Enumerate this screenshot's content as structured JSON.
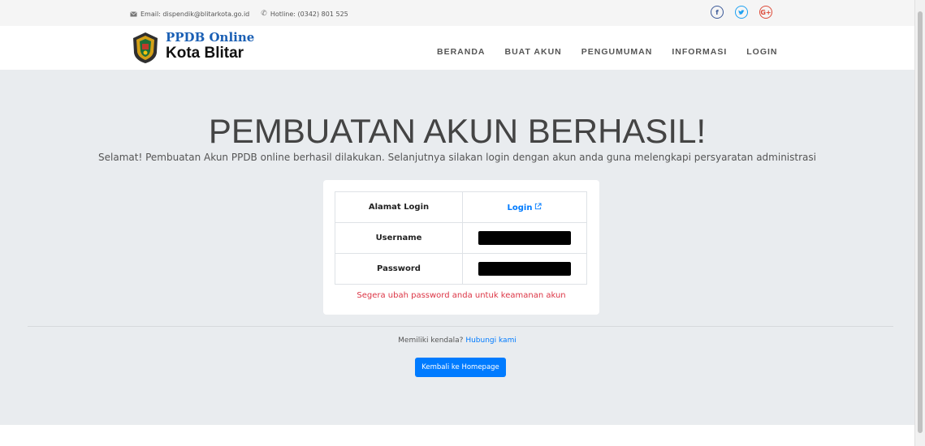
{
  "topbar": {
    "email": "Email: dispendik@blitarkota.go.id",
    "hotline": "Hotline: (0342) 801 525",
    "social_icons": [
      "facebook-icon",
      "twitter-icon",
      "google-plus-icon"
    ]
  },
  "brand": {
    "line1": "PPDB Online",
    "line2": "Kota Blitar"
  },
  "nav": {
    "items": [
      {
        "label": "BERANDA"
      },
      {
        "label": "BUAT AKUN"
      },
      {
        "label": "PENGUMUMAN"
      },
      {
        "label": "INFORMASI"
      },
      {
        "label": "LOGIN"
      }
    ]
  },
  "main": {
    "title": "PEMBUATAN AKUN BERHASIL!",
    "lead": "Selamat! Pembuatan Akun PPDB online berhasil dilakukan. Selanjutnya silakan login dengan akun anda guna melengkapi persyaratan administrasi",
    "table": {
      "rows": [
        {
          "key": "Alamat Login",
          "value": "Login"
        },
        {
          "key": "Username",
          "value": ""
        },
        {
          "key": "Password",
          "value": ""
        }
      ]
    },
    "warning": "Segera ubah password anda untuk keamanan akun",
    "help_text": "Memiliki kendala?",
    "help_link": "Hubungi kami",
    "back_button": "Kembali ke Homepage"
  },
  "colors": {
    "accent": "#007bff",
    "warning": "#dc3545",
    "hero_bg": "#e9ecef"
  }
}
